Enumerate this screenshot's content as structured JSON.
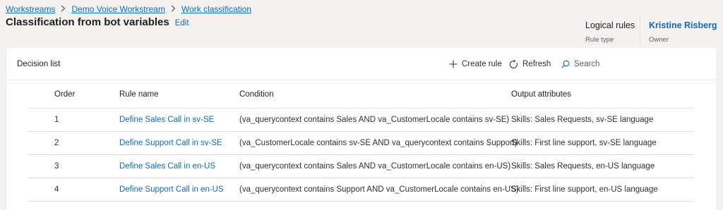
{
  "breadcrumb": {
    "items": [
      "Workstreams",
      "Demo Voice Workstream",
      "Work classification"
    ]
  },
  "header": {
    "title": "Classification from bot variables",
    "edit_label": "Edit",
    "rule_type_value": "Logical rules",
    "rule_type_label": "Rule type",
    "owner_value": "Kristine Risberg",
    "owner_label": "Owner"
  },
  "panel": {
    "title": "Decision list",
    "create_label": "Create rule",
    "refresh_label": "Refresh",
    "search_placeholder": "Search"
  },
  "table": {
    "columns": [
      "Order",
      "Rule name",
      "Condition",
      "Output attributes"
    ],
    "rows": [
      {
        "order": "1",
        "name": "Define Sales Call in sv-SE",
        "condition": "(va_querycontext contains Sales AND va_CustomerLocale contains sv-SE)",
        "output": "Skills: Sales Requests, sv-SE language"
      },
      {
        "order": "2",
        "name": "Define Support Call in sv-SE",
        "condition": "(va_CustomerLocale contains sv-SE AND va_querycontext contains Support)",
        "output": "Skills: First line support, sv-SE language"
      },
      {
        "order": "3",
        "name": "Define Sales Call in en-US",
        "condition": "(va_querycontext contains Sales AND va_CustomerLocale contains en-US)",
        "output": "Skills: Sales Requests, en-US language"
      },
      {
        "order": "4",
        "name": "Define Support Call in en-US",
        "condition": "(va_querycontext contains Support AND va_CustomerLocale contains en-US)",
        "output": "Skills: First line support, en-US language"
      }
    ]
  },
  "colors": {
    "link": "#0f6cbd",
    "background": "#f3f2f1",
    "panel": "#ffffff"
  }
}
